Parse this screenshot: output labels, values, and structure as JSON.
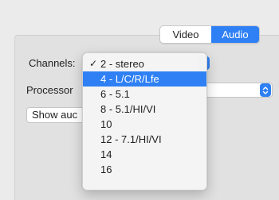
{
  "tabs": {
    "video_label": "Video",
    "audio_label": "Audio",
    "selected": "Audio"
  },
  "form": {
    "channels_label": "Channels:",
    "processor_label": "Processor",
    "show_button_label": "Show auc"
  },
  "channels_menu": {
    "checked": "2 - stereo",
    "highlighted": "4 - L/C/R/Lfe",
    "check_mark": "✓",
    "items": [
      "2 - stereo",
      "4 - L/C/R/Lfe",
      "6 - 5.1",
      "8 - 5.1/HI/VI",
      "10",
      "12 - 7.1/HI/VI",
      "14",
      "16"
    ]
  },
  "colors": {
    "accent": "#2f80f4",
    "window_bg": "#ebebeb",
    "panel_bg": "#e1e1e1"
  },
  "icons": {
    "popup_arrows": "chevron-up-down-icon"
  }
}
